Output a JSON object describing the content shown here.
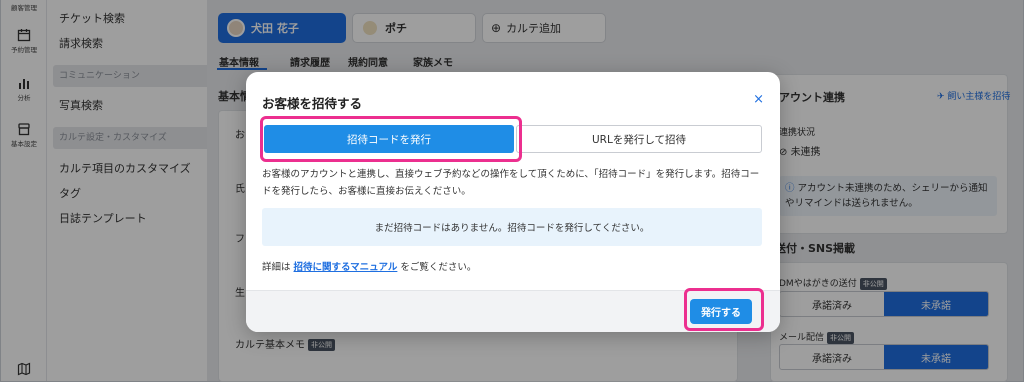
{
  "rail": {
    "items": [
      {
        "label": "顧客管理",
        "icon": "customer-icon"
      },
      {
        "label": "予約管理",
        "icon": "calendar-icon"
      },
      {
        "label": "分析",
        "icon": "chart-icon"
      },
      {
        "label": "基本設定",
        "icon": "store-icon"
      }
    ],
    "bottom_icon": "map-icon"
  },
  "submenu": {
    "items_top": [
      "チケット検索",
      "請求検索"
    ],
    "section_comm": "コミュニケーション",
    "items_comm": [
      "写真検索"
    ],
    "section_karte": "カルテ設定・カスタマイズ",
    "items_karte": [
      "カルテ項目のカスタマイズ",
      "タグ",
      "日誌テンプレート"
    ]
  },
  "main": {
    "tabs": [
      {
        "label": "犬田 花子",
        "active": true
      },
      {
        "label": "ポチ",
        "active": false
      },
      {
        "label": "カルテ追加",
        "active": false
      }
    ],
    "subtabs": [
      "基本情報",
      "請求履歴",
      "規約同意",
      "家族メモ"
    ],
    "left_heading": "基本情",
    "left_field_labels": [
      "お",
      "氏",
      "フ",
      "生"
    ],
    "karte_memo_label": "カルテ基本メモ",
    "private_badge": "非公開",
    "right_heading": "アウント連携",
    "invite_link": "飼い主様を招待",
    "link_status_label": "連携状況",
    "link_status_value": "未連携",
    "link_info": "アカウント未連携のため、シェリーから通知やリマインドは送られません。",
    "sns_heading": "送付・SNS掲載",
    "dm_label": "DMやはがきの送付",
    "mail_label": "メール配信",
    "seg_options": [
      "承諾済み",
      "未承諾"
    ]
  },
  "modal": {
    "title": "お客様を招待する",
    "close": "×",
    "segments": [
      "招待コードを発行",
      "URLを発行して招待"
    ],
    "description": "お客様のアカウントと連携し、直接ウェブ予約などの操作をして頂くために、「招待コード」を発行します。招待コードを発行したら、お客様に直接お伝えください。",
    "notice": "まだ招待コードはありません。招待コードを発行してください。",
    "manual_prefix": "詳細は ",
    "manual_link": "招待に関するマニュアル",
    "manual_suffix": " をご覧ください。",
    "issue_button": "発行する"
  },
  "colors": {
    "accent": "#1f8de6",
    "highlight": "#ec2f8f"
  }
}
